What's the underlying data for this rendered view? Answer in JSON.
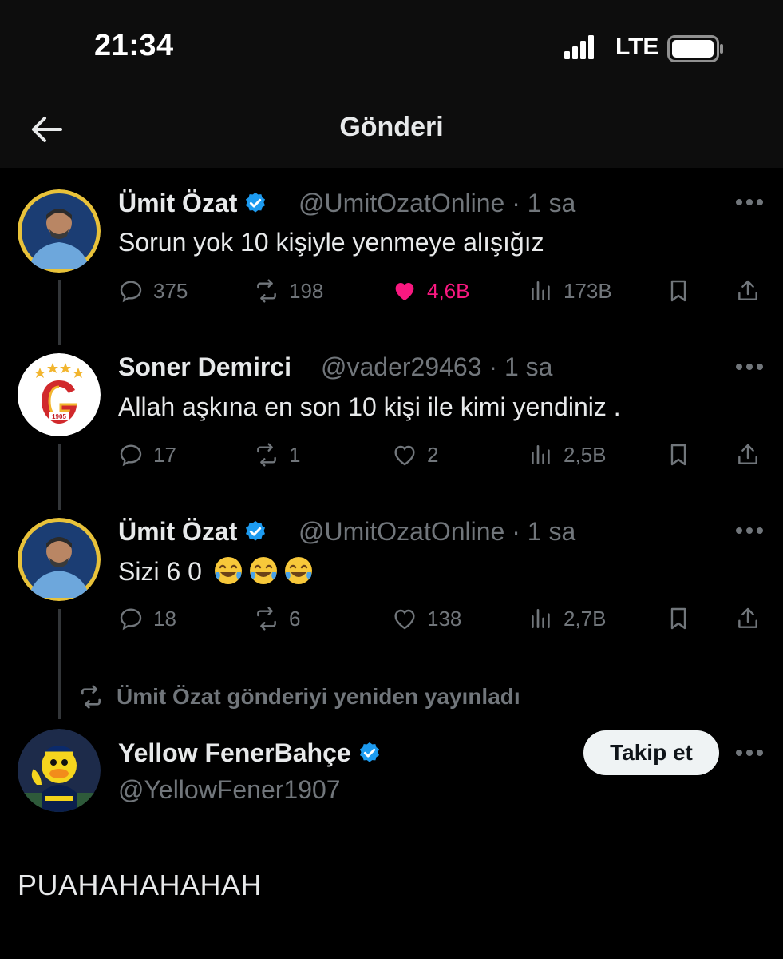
{
  "status": {
    "time": "21:34",
    "network": "LTE"
  },
  "nav": {
    "title": "Gönderi"
  },
  "tweets": [
    {
      "name": "Ümit Özat",
      "verified": true,
      "meta": "@UmitOzatOnline · 1 sa",
      "text": "Sorun yok 10 kişiyle yenmeye alışığız",
      "replies": "375",
      "reposts": "198",
      "likes": "4,6B",
      "views": "173B",
      "liked": true
    },
    {
      "name": "Soner Demirci",
      "verified": false,
      "meta": "@vader29463 · 1 sa",
      "text": "Allah aşkına en son 10 kişi ile kimi yendiniz .",
      "replies": "17",
      "reposts": "1",
      "likes": "2",
      "views": "2,5B",
      "liked": false
    },
    {
      "name": "Ümit Özat",
      "verified": true,
      "meta": "@UmitOzatOnline · 1 sa",
      "text": "Sizi 6 0",
      "replies": "18",
      "reposts": "6",
      "likes": "138",
      "views": "2,7B",
      "liked": false
    }
  ],
  "repost_note": "Ümit Özat gönderiyi yeniden yayınladı",
  "main_post": {
    "name": "Yellow FenerBahçe",
    "handle": "@YellowFener1907",
    "follow_label": "Takip et",
    "text": "PUAHAHAHAHAH"
  },
  "avatar_badge_year": "1905",
  "colors": {
    "accent_blue": "#1d9bf0",
    "like_pink": "#f91880",
    "muted": "#71767b"
  }
}
